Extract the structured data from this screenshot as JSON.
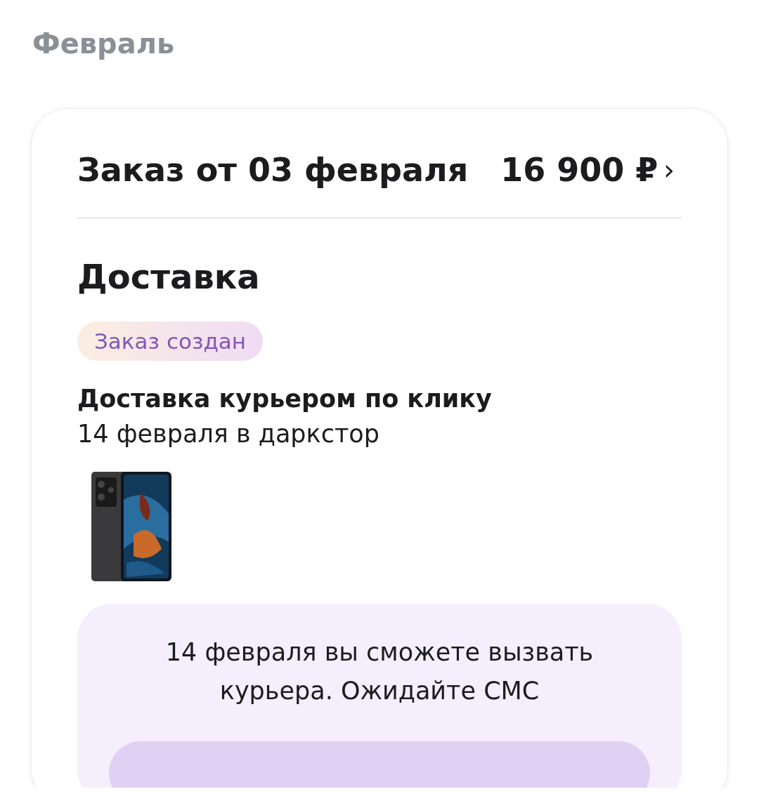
{
  "month_heading": "Февраль",
  "order": {
    "title": "Заказ от 03 февраля",
    "total": "16 900 ₽",
    "chevron": "›",
    "section_title": "Доставка",
    "status_badge": "Заказ создан",
    "delivery_method": "Доставка курьером по клику",
    "delivery_date": "14 февраля в даркстор",
    "notice": {
      "text": "14 февраля вы сможете вызвать курьера. Ожидайте СМС"
    }
  }
}
